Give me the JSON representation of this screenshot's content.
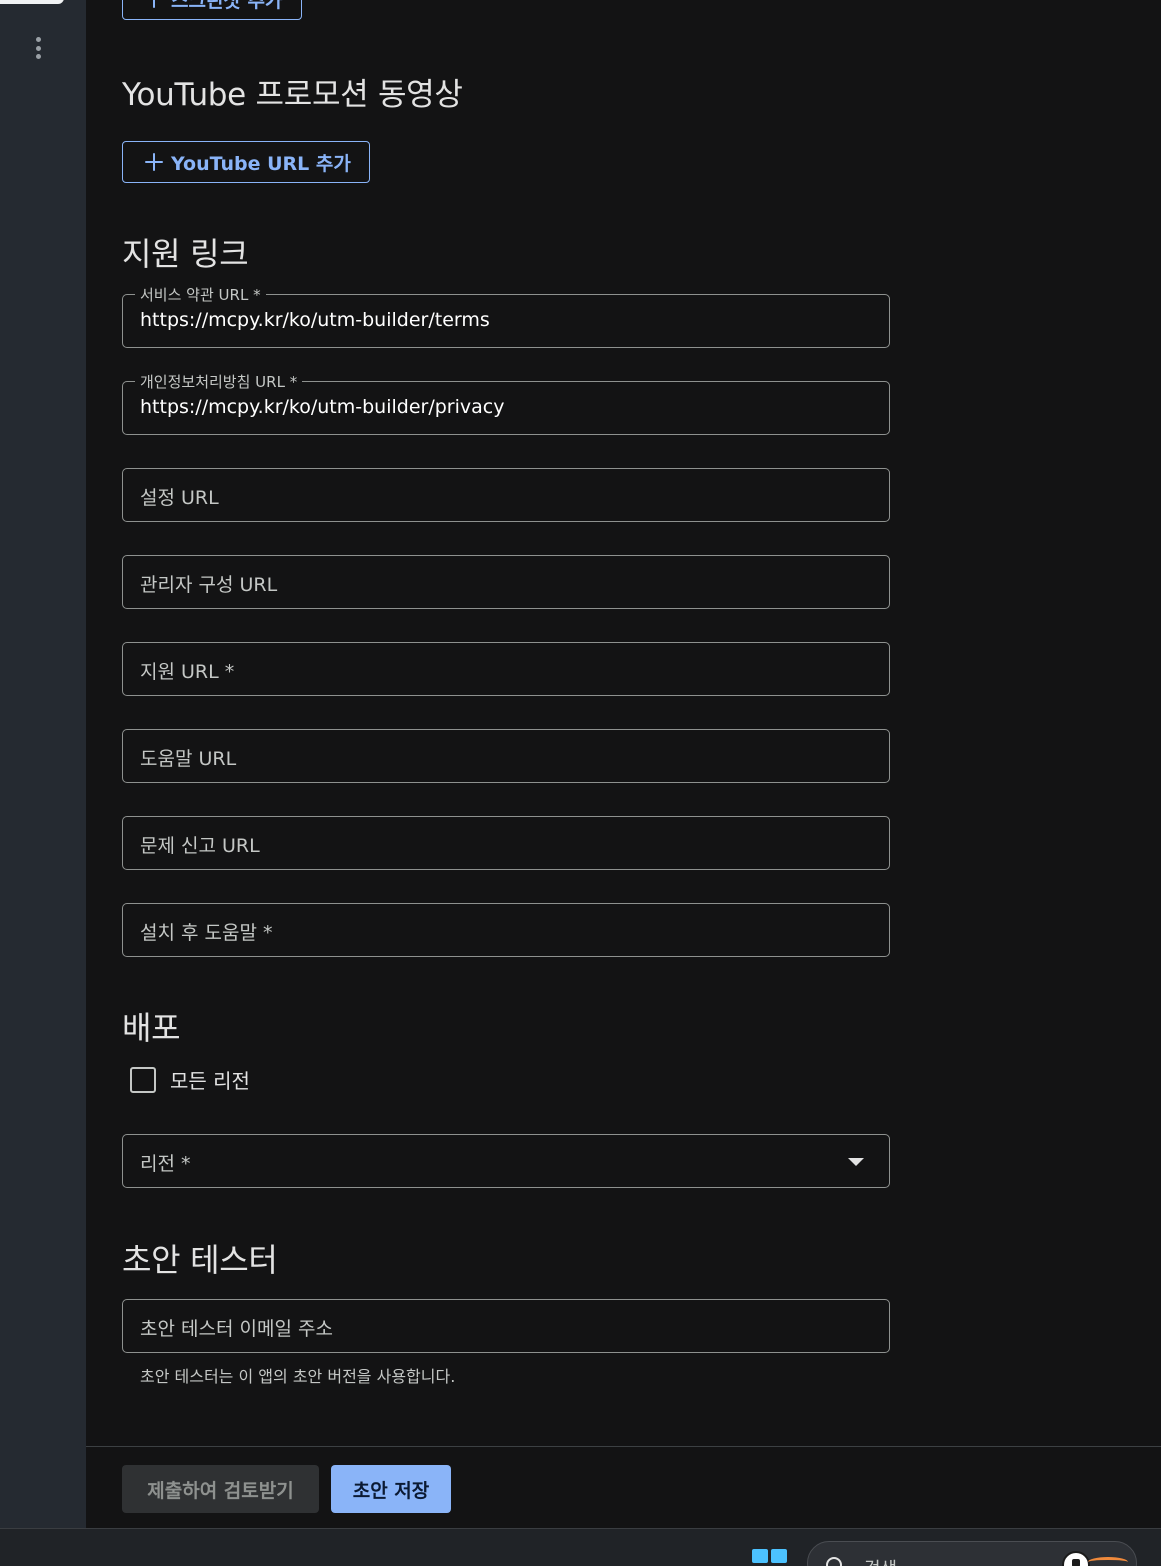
{
  "top_cut_button_label": "스크린샷 추가",
  "youtube_section": {
    "title": "YouTube 프로모션 동영상",
    "add_button_label": "YouTube URL 추가"
  },
  "support_links": {
    "title": "지원 링크",
    "terms_field": {
      "label": "서비스 약관 URL *",
      "value": "https://mcpy.kr/ko/utm-builder/terms"
    },
    "privacy_field": {
      "label": "개인정보처리방침 URL *",
      "value": "https://mcpy.kr/ko/utm-builder/privacy"
    },
    "settings_field": {
      "placeholder": "설정 URL"
    },
    "admin_config_field": {
      "placeholder": "관리자 구성 URL"
    },
    "support_field": {
      "placeholder": "지원 URL *"
    },
    "help_field": {
      "placeholder": "도움말 URL"
    },
    "report_issue_field": {
      "placeholder": "문제 신고 URL"
    },
    "post_install_help_field": {
      "placeholder": "설치 후 도움말 *"
    }
  },
  "distribution": {
    "title": "배포",
    "all_regions_label": "모든 리전",
    "all_regions_checked": false,
    "region_select": {
      "placeholder": "리전 *"
    }
  },
  "draft_testers": {
    "title": "초안 테스터",
    "email_field": {
      "placeholder": "초안 테스터 이메일 주소"
    },
    "helper_text": "초안 테스터는 이 앱의 초안 버전을 사용합니다."
  },
  "footer": {
    "submit_label": "제출하여 검토받기",
    "save_draft_label": "초안 저장"
  },
  "taskbar": {
    "search_text": "검색"
  },
  "colors": {
    "background": "#131314",
    "accent": "#8ab4f8",
    "rail": "#252a31",
    "field_border": "#8e918f"
  }
}
